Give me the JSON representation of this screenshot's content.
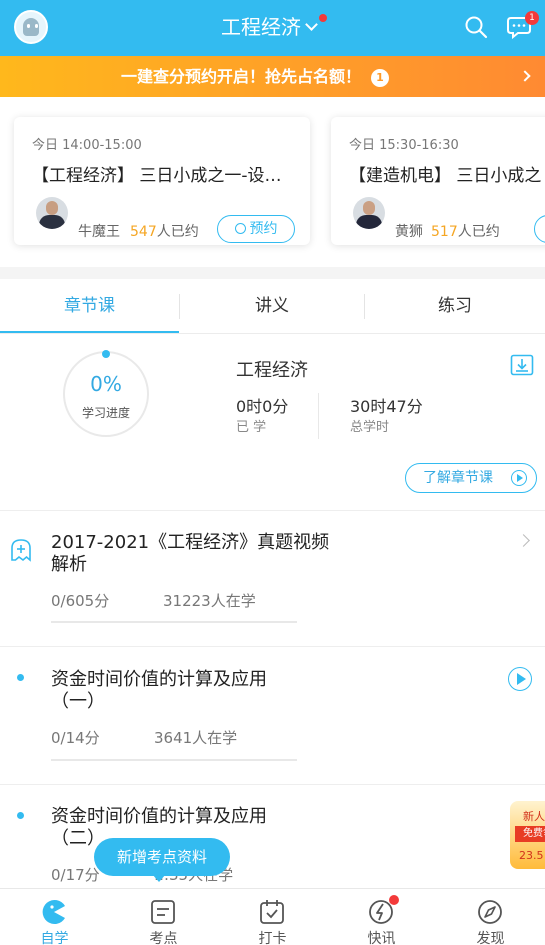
{
  "header": {
    "title": "工程经济",
    "message_badge": "1",
    "accent_color": "#33bbf0"
  },
  "banner": {
    "text": "一建查分预约开启！抢先占名额！",
    "number": "1"
  },
  "live_cards": [
    {
      "time": "今日 14:00-15:00",
      "title": "【工程经济】 三日小成之一-设…",
      "teacher": "牛魔王",
      "count": "547",
      "count_suffix": "人已约",
      "button": "预约"
    },
    {
      "time": "今日 15:30-16:30",
      "title": "【建造机电】 三日小成之",
      "teacher": "黄狮",
      "count": "517",
      "count_suffix": "人已约",
      "button": ""
    }
  ],
  "tabs": [
    "章节课",
    "讲义",
    "练习"
  ],
  "progress": {
    "percent": "0%",
    "label": "学习进度",
    "value": 0,
    "subject": "工程经济",
    "learned_value": "0时0分",
    "learned_label": "已 学",
    "total_value": "30时47分",
    "total_label": "总学时",
    "learn_button": "了解章节课"
  },
  "courses": [
    {
      "title": "2017-2021《工程经济》真题视频解析",
      "score": "0/605分",
      "learners": "31223人在学"
    },
    {
      "title": "资金时间价值的计算及应用（一）",
      "score": "0/14分",
      "learners": "3641人在学"
    },
    {
      "title": "资金时间价值的计算及应用（二）",
      "score": "0/17分",
      "learners": "…35人在学"
    }
  ],
  "promo": {
    "line1": "新人",
    "line2": "免费领",
    "line3": "23.5"
  },
  "tooltip": "新增考点资料",
  "bottom_nav": [
    {
      "label": "自学",
      "icon": "self-study-icon"
    },
    {
      "label": "考点",
      "icon": "exam-points-icon"
    },
    {
      "label": "打卡",
      "icon": "check-in-icon"
    },
    {
      "label": "快讯",
      "icon": "flash-news-icon"
    },
    {
      "label": "发现",
      "icon": "discover-icon"
    }
  ]
}
